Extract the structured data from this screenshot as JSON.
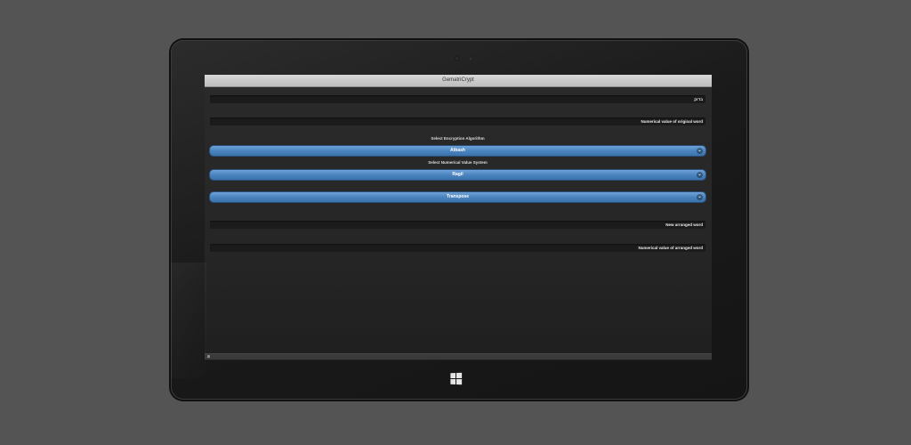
{
  "app": {
    "title": "GematriCrypt"
  },
  "fields": {
    "input_placeholder": "בדוק",
    "original_value_label": "Numerical value of original word",
    "arranged_word_label": "New arranged word",
    "arranged_value_label": "Numerical value of arranged word"
  },
  "algorithm": {
    "label": "Select Encryption Algorithm",
    "selected": "Atbash"
  },
  "numeric_system": {
    "label": "Select Numerical Value System",
    "selected": "Ragil"
  },
  "operation": {
    "selected": "Transpose"
  },
  "icons": {
    "dropdown": "chevron-down-icon",
    "os": "windows-logo-icon",
    "camera": "camera-icon"
  },
  "colors": {
    "accent": "#4a84bf",
    "background": "#545454",
    "screen": "#262626"
  }
}
